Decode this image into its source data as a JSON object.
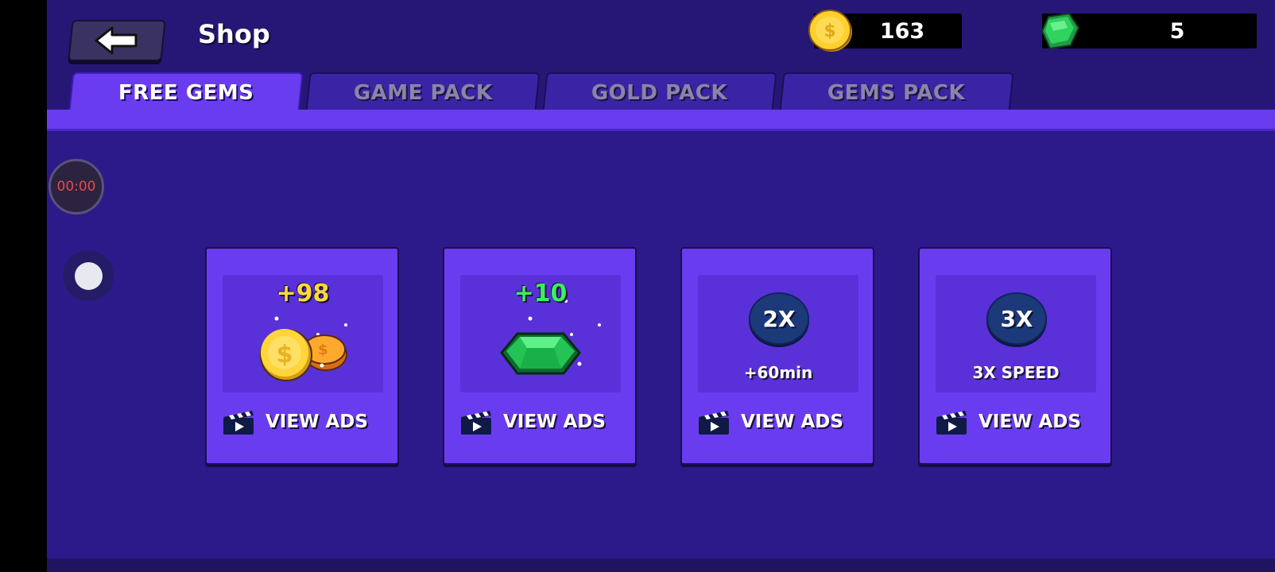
{
  "header": {
    "title": "Shop",
    "coins": "163",
    "gems": "5"
  },
  "tabs": [
    {
      "label": "FREE GEMS",
      "active": true
    },
    {
      "label": "GAME PACK",
      "active": false
    },
    {
      "label": "GOLD PACK",
      "active": false
    },
    {
      "label": "GEMS PACK",
      "active": false
    }
  ],
  "overlay": {
    "timer": "00:00"
  },
  "cards": [
    {
      "reward": "+98",
      "reward_color": "#ffd93a",
      "icon": "gold-coins-icon",
      "action": "VIEW ADS"
    },
    {
      "reward": "+10",
      "reward_color": "#3cf05a",
      "icon": "green-gem-icon",
      "action": "VIEW ADS"
    },
    {
      "badge": "2X",
      "detail": "+60min",
      "action": "VIEW ADS"
    },
    {
      "badge": "3X",
      "detail": "3X SPEED",
      "action": "VIEW ADS"
    }
  ],
  "colors": {
    "background": "#2c1a8a",
    "accent": "#6a3cf0",
    "coin": "#ffc928",
    "gem": "#22c45a"
  }
}
